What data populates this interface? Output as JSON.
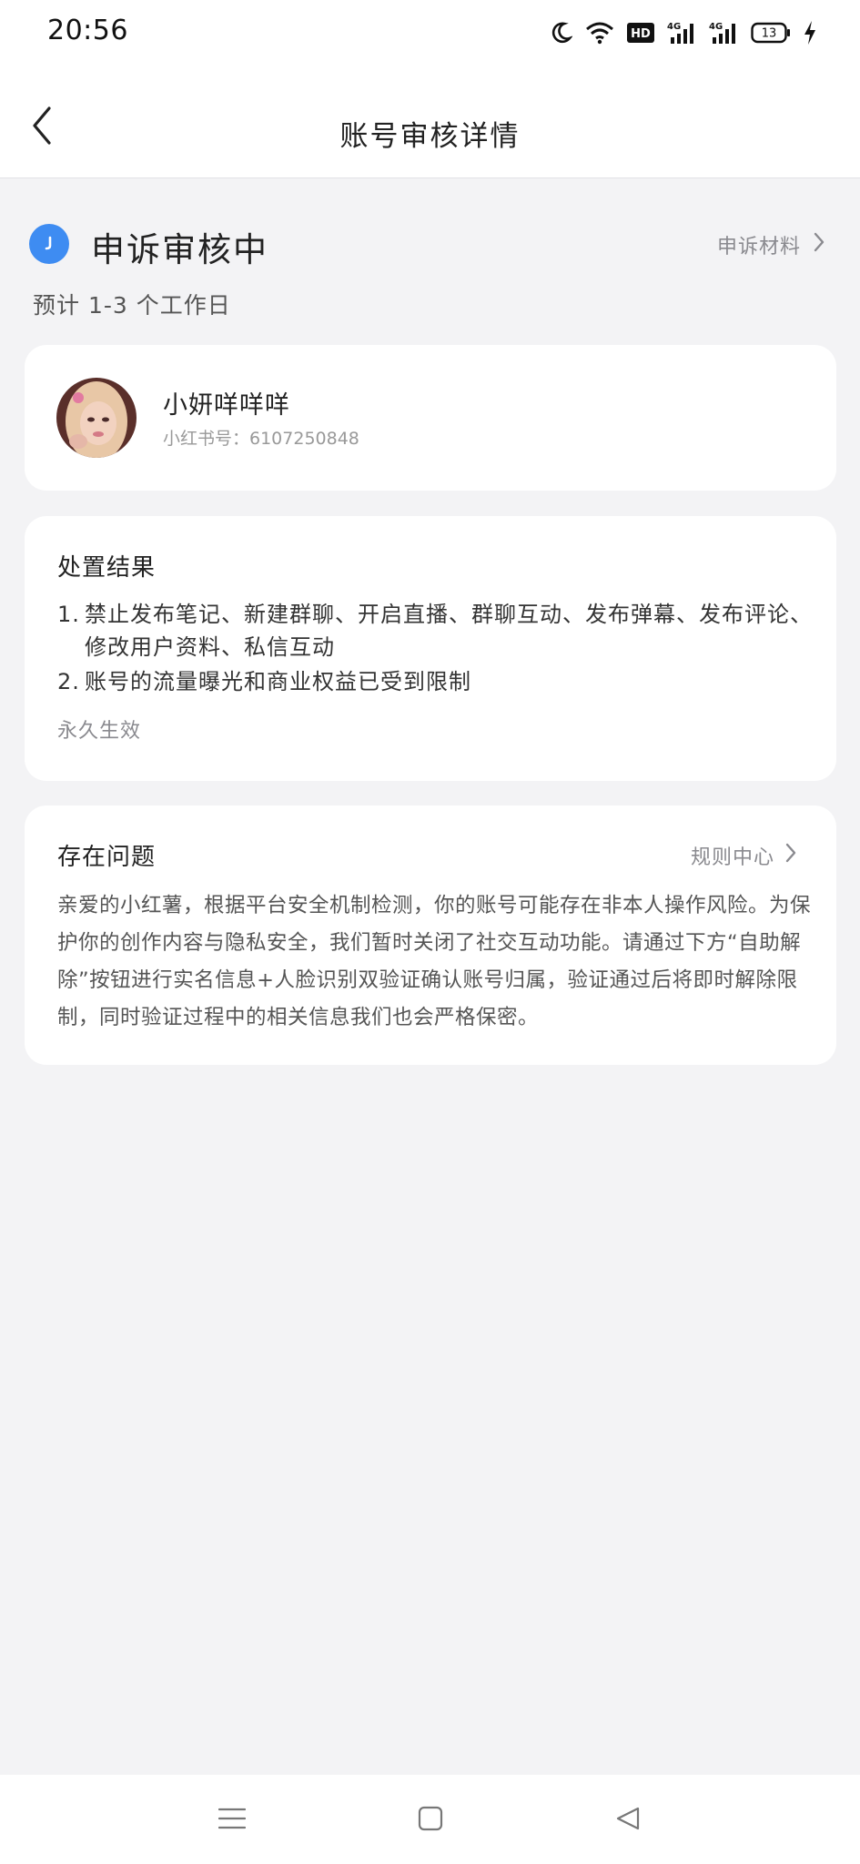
{
  "status_bar": {
    "time": "20:56",
    "icons": [
      "moon-icon",
      "wifi-icon",
      "hd-icon",
      "signal-4g-icon",
      "signal-4g-icon",
      "battery-icon",
      "charging-icon"
    ],
    "battery_level": "13",
    "network_label": "4G",
    "hd_label": "HD"
  },
  "nav": {
    "title": "账号审核详情",
    "back_icon": "chevron-left-icon"
  },
  "appeal_status": {
    "title": "申诉审核中",
    "status_icon": "clock-icon",
    "status_color": "#3e8cf2",
    "link_label": "申诉材料",
    "estimate": "预计 1-3 个工作日"
  },
  "profile": {
    "name": "小妍咩咩咩",
    "id_text": "小红书号：6107250848"
  },
  "result": {
    "heading": "处置结果",
    "items": [
      {
        "num": "1.",
        "text": "禁止发布笔记、新建群聊、开启直播、群聊互动、发布弹幕、发布评论、修改用户资料、私信互动"
      },
      {
        "num": "2.",
        "text": "账号的流量曝光和商业权益已受到限制"
      }
    ],
    "duration": "永久生效"
  },
  "issue": {
    "heading": "存在问题",
    "link_label": "规则中心",
    "body": "亲爱的小红薯，根据平台安全机制检测，你的账号可能存在非本人操作风险。为保护你的创作内容与隐私安全，我们暂时关闭了社交互动功能。请通过下方“自助解除”按钮进行实名信息+人脸识别双验证确认账号归属，验证通过后将即时解除限制，同时验证过程中的相关信息我们也会严格保密。"
  },
  "system_nav": {
    "icons": [
      "menu-icon",
      "home-square-icon",
      "back-triangle-icon"
    ]
  }
}
